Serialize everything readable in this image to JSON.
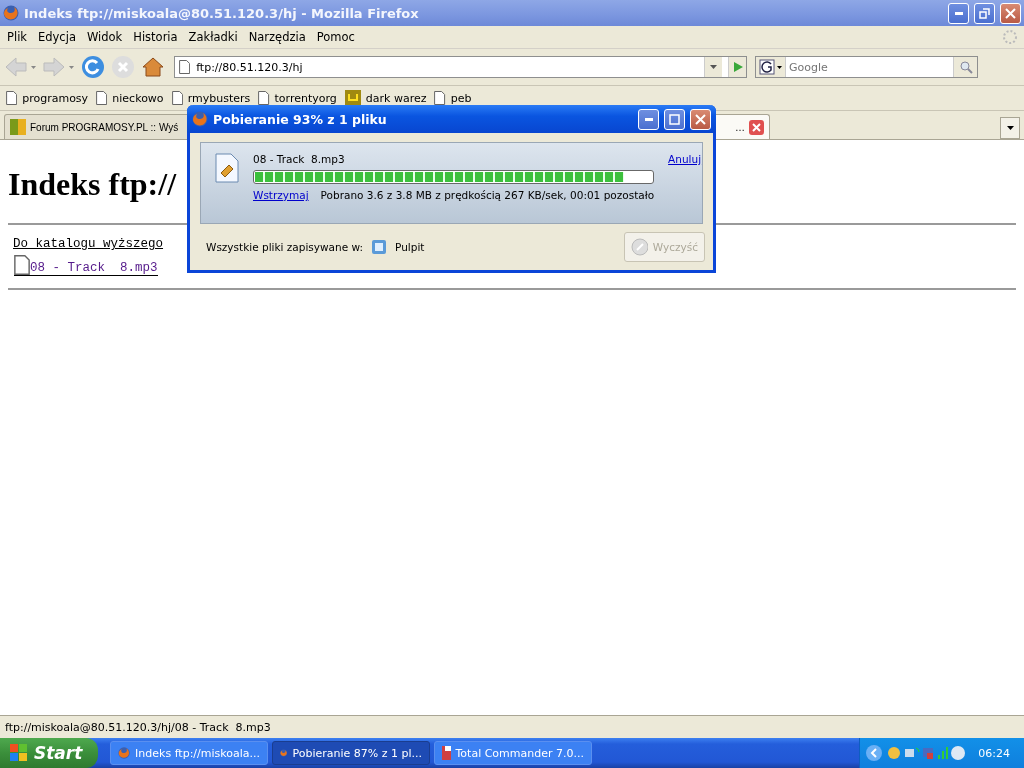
{
  "window": {
    "title": "Indeks ftp://miskoala@80.51.120.3/hj - Mozilla Firefox"
  },
  "menu": [
    "Plik",
    "Edycja",
    "Widok",
    "Historia",
    "Zakładki",
    "Narzędzia",
    "Pomoc"
  ],
  "address": {
    "value": "ftp://80.51.120.3/hj"
  },
  "search": {
    "placeholder": "Google"
  },
  "bookmarks": [
    {
      "label": "programosy",
      "kind": "page"
    },
    {
      "label": "nieckowo",
      "kind": "page"
    },
    {
      "label": "rmybusters",
      "kind": "page"
    },
    {
      "label": "torrentyorg",
      "kind": "page"
    },
    {
      "label": "dark warez",
      "kind": "folder"
    },
    {
      "label": "peb",
      "kind": "page"
    }
  ],
  "tabs": [
    {
      "label": "Forum PROGRAMOSY.PL :: Wyś",
      "selected": false
    },
    {
      "label": "…",
      "selected": true
    }
  ],
  "page": {
    "heading": "Indeks ftp://",
    "parent_link": "Do katalogu wyższego",
    "files": [
      "08 - Track  8.mp3"
    ]
  },
  "download_dialog": {
    "title": "Pobieranie 93% z 1 pliku",
    "file": "08 - Track  8.mp3",
    "level": 0.93,
    "cancel": "Anuluj",
    "pause": "Wstrzymaj",
    "status": "Pobrano 3.6 z 3.8 MB z prędkością 267 KB/sek, 00:01 pozostało",
    "save_label": "Wszystkie pliki zapisywane w:",
    "folder": "Pulpit",
    "clear_button": {
      "label": "Wyczyść",
      "disabled": true
    }
  },
  "status_bar": "ftp://miskoala@80.51.120.3/hj/08 - Track  8.mp3",
  "taskbar": {
    "start": "Start",
    "items": [
      {
        "label": "Indeks ftp://miskoala...",
        "kind": "firefox",
        "selected": false
      },
      {
        "label": "Pobieranie 87% z 1 pl...",
        "kind": "firefox",
        "selected": true
      },
      {
        "label": "Total Commander 7.0...",
        "kind": "disk",
        "selected": false
      }
    ],
    "clock": "06:24"
  }
}
